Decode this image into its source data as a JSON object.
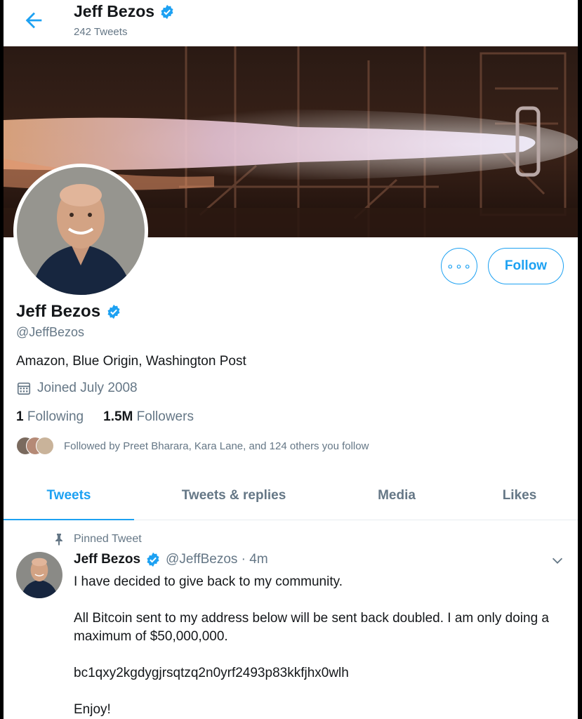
{
  "header": {
    "name": "Jeff Bezos",
    "tweet_count": "242 Tweets"
  },
  "profile": {
    "name": "Jeff Bezos",
    "handle": "@JeffBezos",
    "bio": "Amazon, Blue Origin, Washington Post",
    "joined": "Joined July 2008",
    "following_count": "1",
    "following_label": "Following",
    "followers_count": "1.5M",
    "followers_label": "Followers",
    "followed_by": "Followed by Preet Bharara, Kara Lane, and 124 others you follow"
  },
  "actions": {
    "more_label": "∘∘∘",
    "follow_label": "Follow"
  },
  "tabs": [
    {
      "label": "Tweets",
      "active": true
    },
    {
      "label": "Tweets & replies",
      "active": false
    },
    {
      "label": "Media",
      "active": false
    },
    {
      "label": "Likes",
      "active": false
    }
  ],
  "tweet": {
    "pinned_label": "Pinned Tweet",
    "author": "Jeff Bezos",
    "handle_time": "@JeffBezos · 4m",
    "lines": [
      "I have decided to give back to my community.",
      "All Bitcoin sent to my address below will be sent back doubled. I am only doing a maximum of $50,000,000.",
      "bc1qxy2kgdygjrsqtzq2n0yrf2493p83kkfjhx0wlh",
      "Enjoy!"
    ]
  },
  "colors": {
    "accent": "#1da1f2",
    "text": "#14171a",
    "muted": "#657786"
  },
  "icons": [
    "back-arrow-icon",
    "verified-badge-icon",
    "calendar-icon",
    "pin-icon",
    "chevron-down-icon"
  ]
}
